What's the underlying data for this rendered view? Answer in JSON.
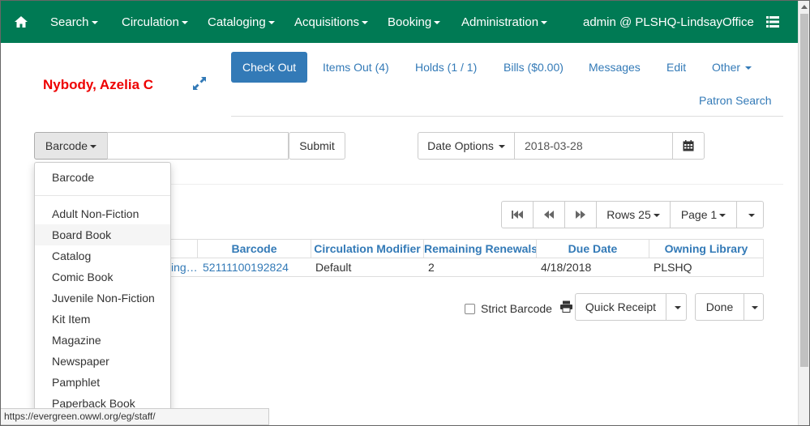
{
  "navbar": {
    "search": "Search",
    "circulation": "Circulation",
    "cataloging": "Cataloging",
    "acquisitions": "Acquisitions",
    "booking": "Booking",
    "administration": "Administration",
    "user": "admin @ PLSHQ-LindsayOffice",
    "colors": {
      "bg": "#007a54"
    }
  },
  "patron": {
    "name": "Nybody, Azelia C"
  },
  "tabs": {
    "check_out": "Check Out",
    "items_out": "Items Out (4)",
    "holds": "Holds (1 / 1)",
    "bills": "Bills ($0.00)",
    "messages": "Messages",
    "edit": "Edit",
    "other": "Other",
    "patron_search": "Patron Search"
  },
  "checkout": {
    "barcode_type": "Barcode",
    "barcode_value": "",
    "submit": "Submit",
    "date_options": "Date Options",
    "date_value": "2018-03-28"
  },
  "pager": {
    "rows": "Rows 25",
    "page": "Page 1"
  },
  "grid": {
    "columns": [
      "Barcode",
      "Circulation Modifier",
      "Remaining Renewals",
      "Due Date",
      "Owning Library"
    ],
    "rows": [
      {
        "title_partial": "ing…",
        "barcode": "52111100192824",
        "circ_modifier": "Default",
        "remaining_renewals": "2",
        "due_date": "4/18/2018",
        "owning_library": "PLSHQ"
      }
    ]
  },
  "actions": {
    "strict_barcode": "Strict Barcode",
    "strict_checked": false,
    "quick_receipt": "Quick Receipt",
    "done": "Done"
  },
  "dropdown": {
    "items": [
      "Barcode",
      "Adult Non-Fiction",
      "Board Book",
      "Catalog",
      "Comic Book",
      "Juvenile Non-Fiction",
      "Kit Item",
      "Magazine",
      "Newspaper",
      "Pamphlet",
      "Paperback Book"
    ],
    "highlighted": "Board Book"
  },
  "status_url": "https://evergreen.owwl.org/eg/staff/"
}
